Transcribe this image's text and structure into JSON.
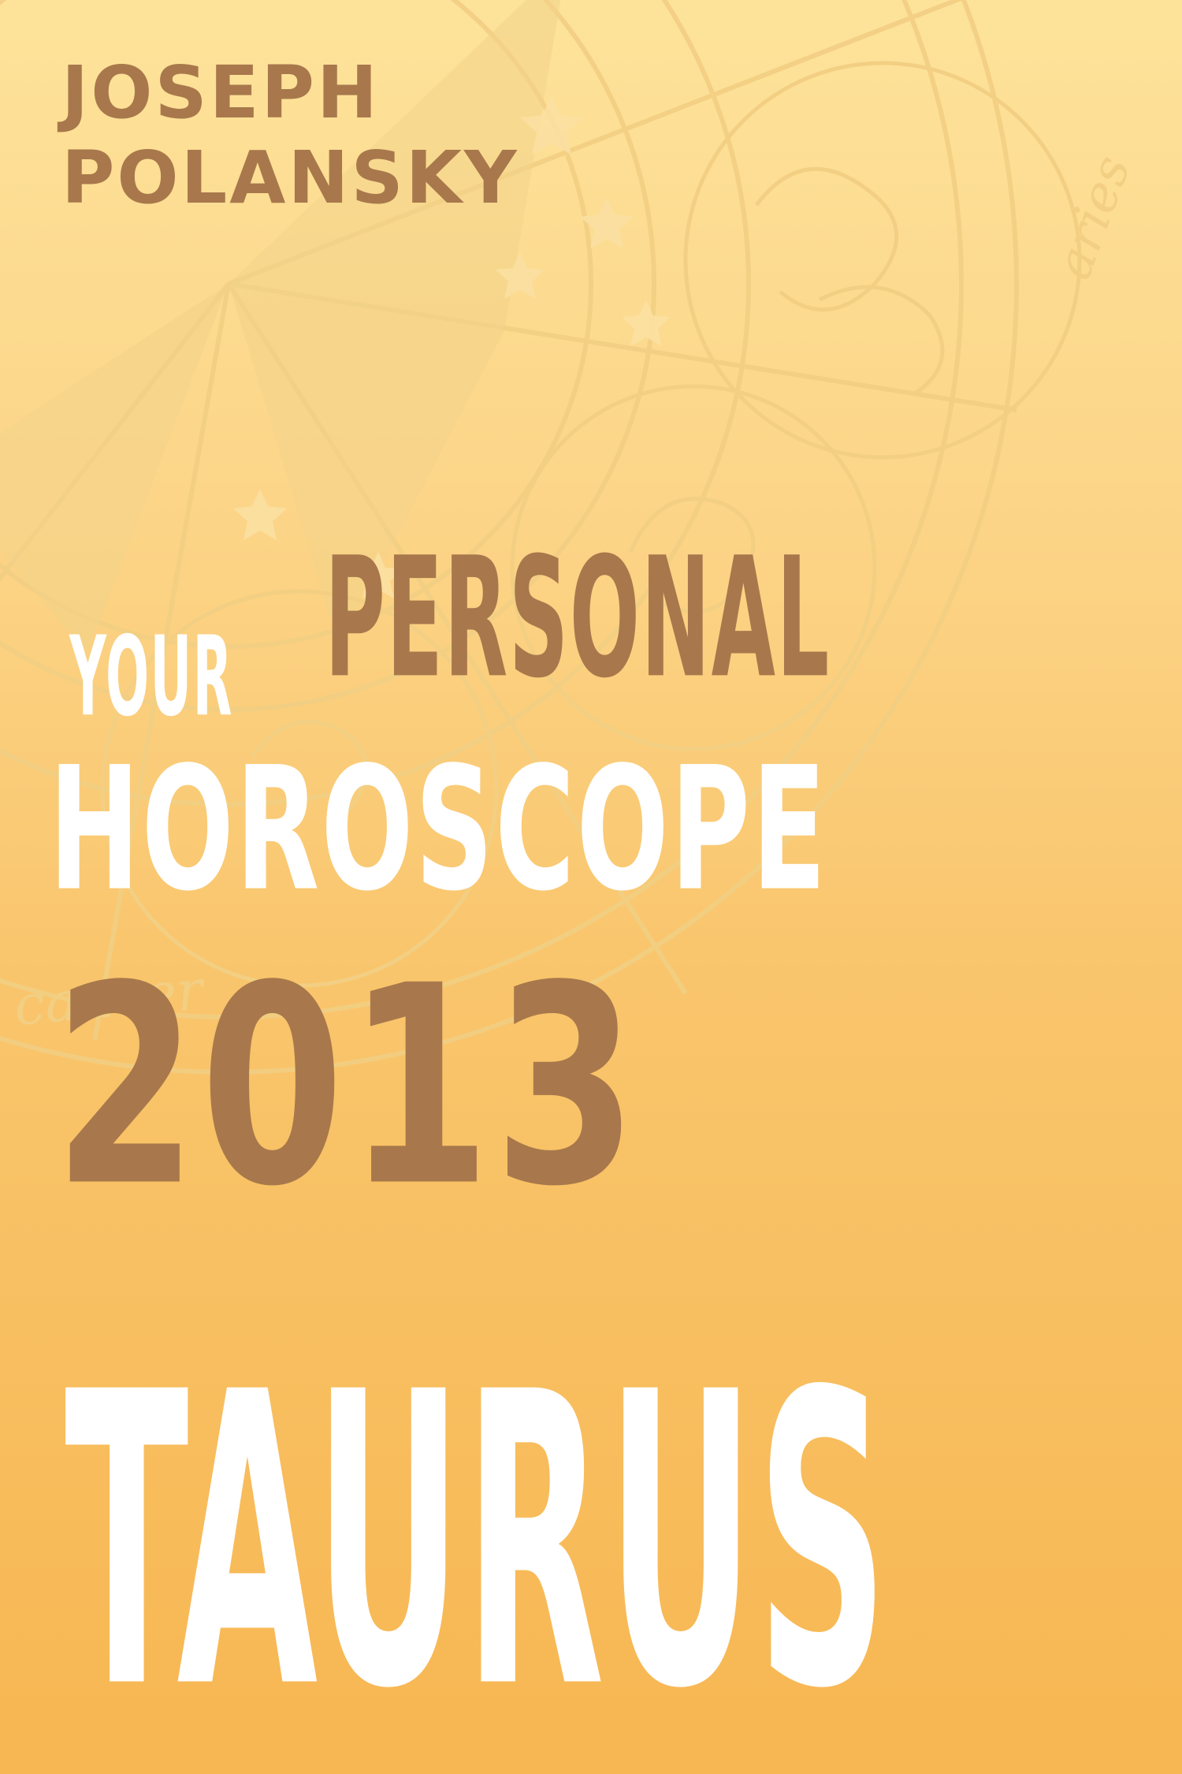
{
  "author": {
    "first": "JOSEPH",
    "last": "POLANSKY"
  },
  "title": {
    "word1": "YOUR",
    "word2": "PERSONAL",
    "word3": "HOROSCOPE",
    "year": "2013",
    "sign": "TAURUS"
  },
  "wheel_labels": {
    "aries": "aries",
    "cancer": "cancer"
  },
  "colors": {
    "brown_text": "#a8784c",
    "white_text": "#ffffff",
    "background_top": "#fde39a",
    "background_bottom": "#f7b752",
    "line_art": "#f2cf83"
  }
}
